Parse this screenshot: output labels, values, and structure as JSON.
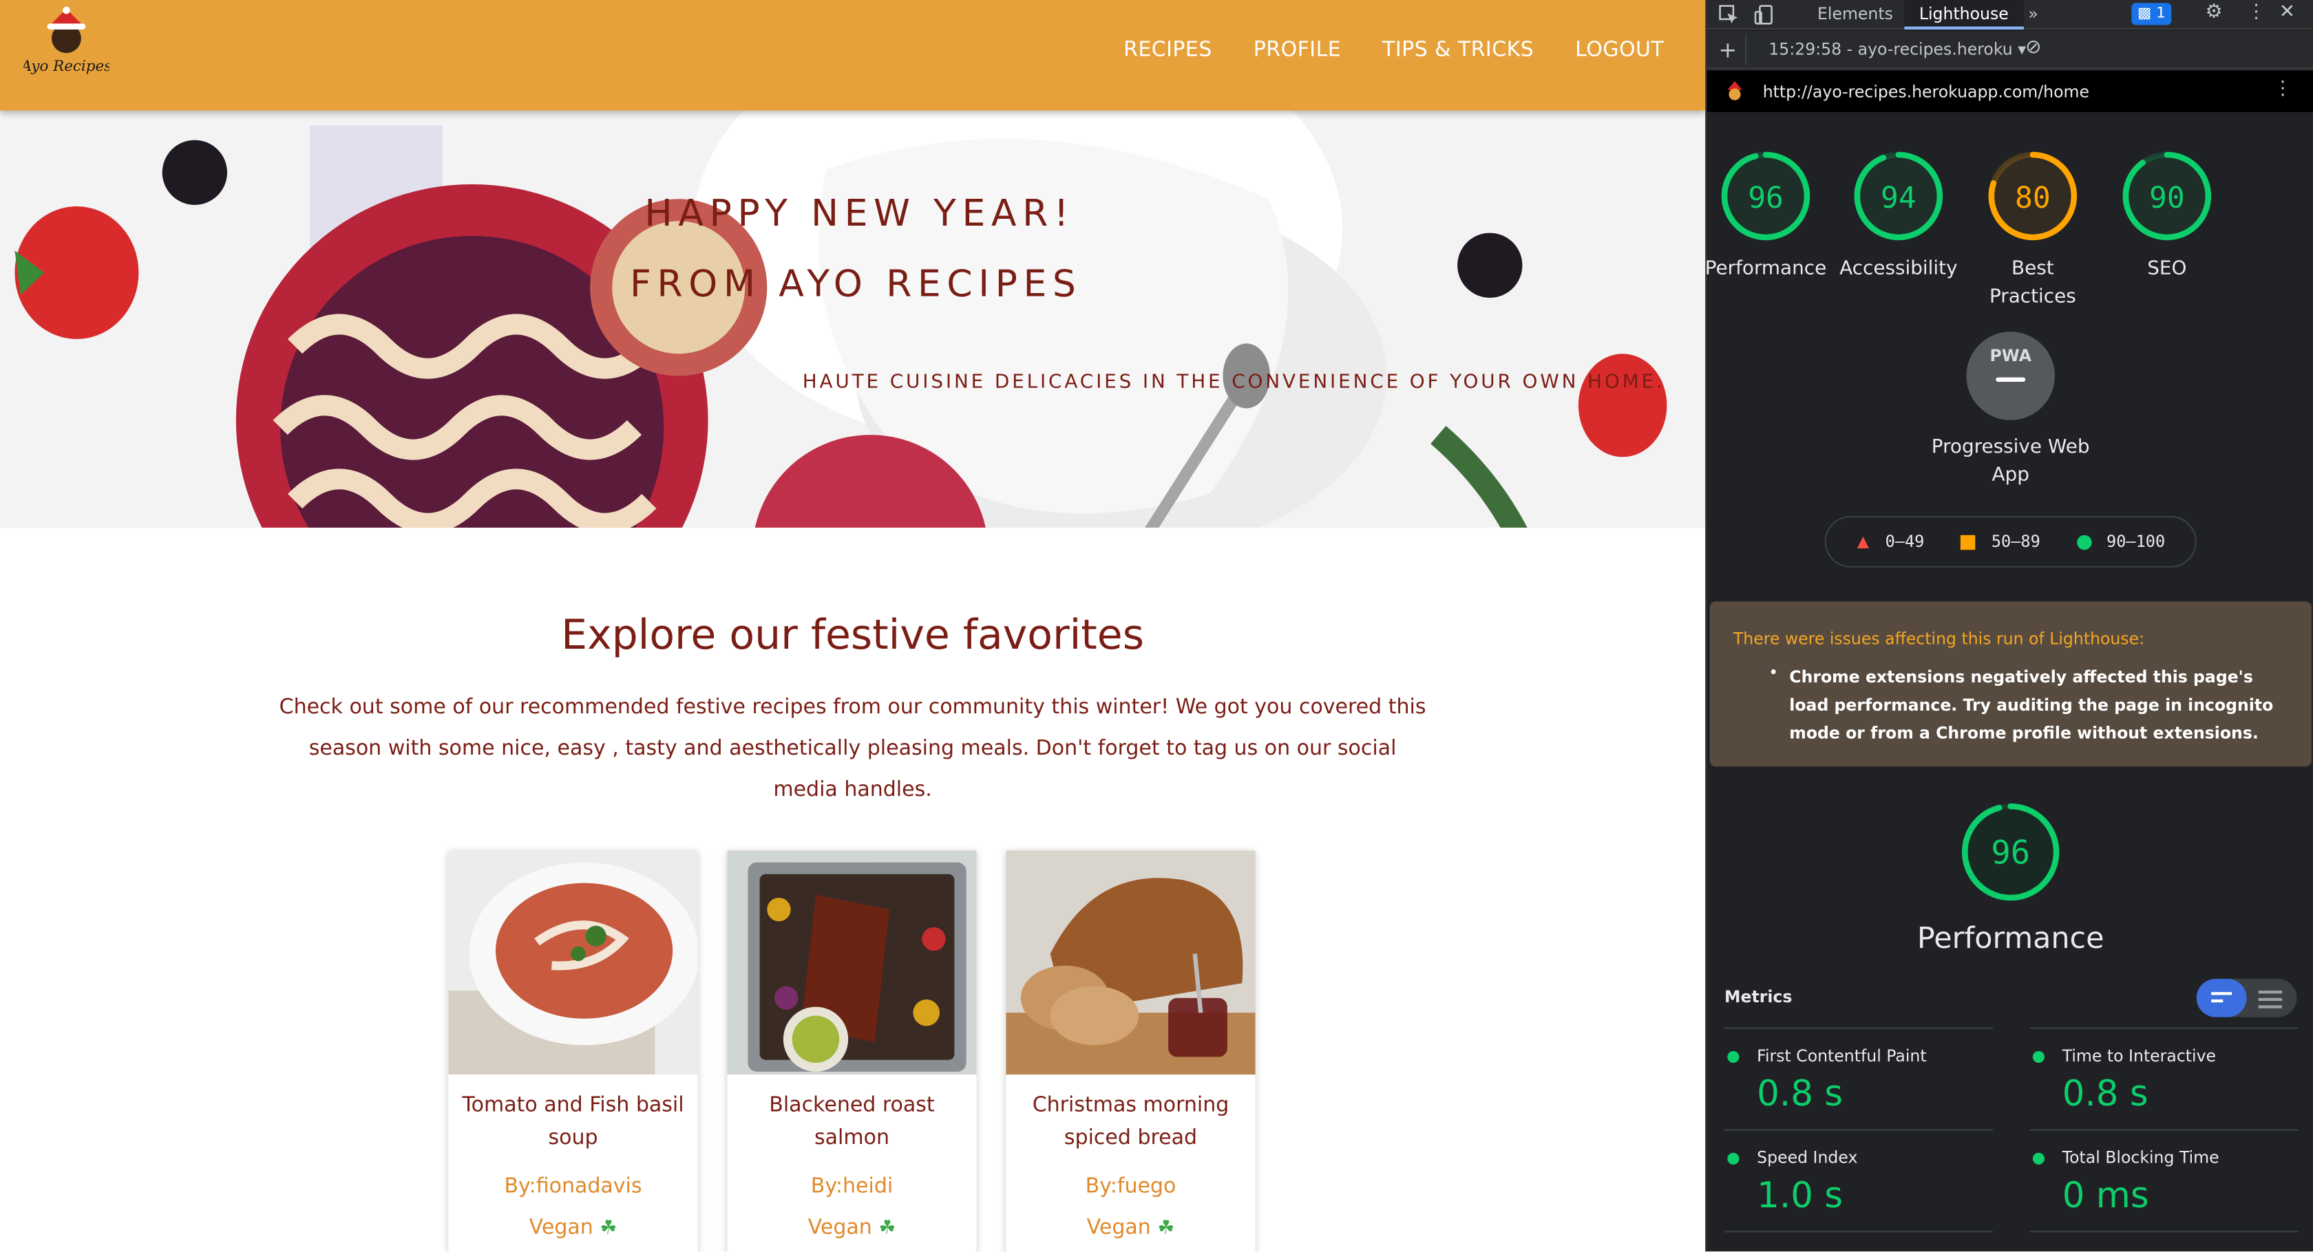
{
  "site": {
    "logo_text": "Ayo Recipes",
    "nav": [
      "RECIPES",
      "PROFILE",
      "TIPS & TRICKS",
      "LOGOUT"
    ],
    "hero": {
      "line1": "HAPPY NEW YEAR!",
      "line2": "FROM AYO RECIPES",
      "tagline": "HAUTE CUISINE DELICACIES IN THE CONVENIENCE OF YOUR OWN HOME."
    },
    "section_title": "Explore our festive favorites",
    "section_desc": "Check out some of our recommended festive recipes from our community this winter! We got you covered this season with some nice, easy , tasty and aesthetically pleasing meals. Don't forget to tag us on our social media handles.",
    "cards": [
      {
        "title": "Tomato and Fish basil soup",
        "author": "By:fionadavis",
        "tag": "Vegan"
      },
      {
        "title": "Blackened roast salmon",
        "author": "By:heidi",
        "tag": "Vegan"
      },
      {
        "title": "Christmas morning spiced bread",
        "author": "By:fuego",
        "tag": "Vegan"
      }
    ]
  },
  "devtools": {
    "tabs": [
      "Elements",
      "Lighthouse"
    ],
    "active_tab": "Lighthouse",
    "issues_count": "1",
    "session": "15:29:58 - ayo-recipes.heroku",
    "url": "http://ayo-recipes.herokuapp.com/home",
    "scores": [
      {
        "value": 96,
        "label": "Performance",
        "color": "#0cce6b"
      },
      {
        "value": 94,
        "label": "Accessibility",
        "color": "#0cce6b"
      },
      {
        "value": 80,
        "label": "Best Practices",
        "color": "#ffa400"
      },
      {
        "value": 90,
        "label": "SEO",
        "color": "#0cce6b"
      }
    ],
    "pwa_label": "Progressive Web App",
    "pwa_badge": "PWA",
    "legend": [
      "0–49",
      "50–89",
      "90–100"
    ],
    "warning_title": "There were issues affecting this run of Lighthouse:",
    "warning_item": "Chrome extensions negatively affected this page's load performance. Try auditing the page in incognito mode or from a Chrome profile without extensions.",
    "perf_score": 96,
    "perf_label": "Performance",
    "metrics_title": "Metrics",
    "metrics": [
      {
        "name": "First Contentful Paint",
        "value": "0.8 s"
      },
      {
        "name": "Time to Interactive",
        "value": "0.8 s"
      },
      {
        "name": "Speed Index",
        "value": "1.0 s"
      },
      {
        "name": "Total Blocking Time",
        "value": "0 ms"
      }
    ]
  }
}
